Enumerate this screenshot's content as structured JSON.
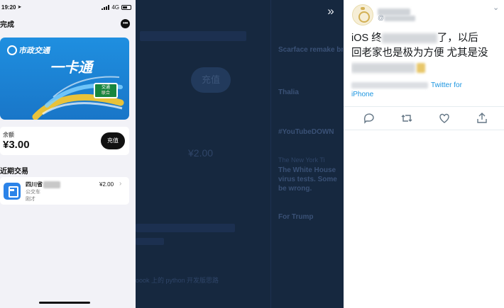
{
  "phone": {
    "status": {
      "time": "19:20",
      "network": "4G"
    },
    "nav": {
      "done_label": "完成",
      "more_glyph": "•••"
    },
    "card": {
      "logo_text": "市政交通",
      "big_text": "一卡通",
      "badge_top": "交通",
      "badge_bottom": "联合"
    },
    "balance": {
      "label": "余额",
      "value": "¥3.00",
      "recharge_label": "充值"
    },
    "recent": {
      "title": "近期交易",
      "transactions": [
        {
          "name": "四川省",
          "type": "公交车",
          "time": "刚才",
          "amount": "¥2.00"
        }
      ]
    }
  },
  "background": {
    "lines": [
      {
        "text": "充值"
      },
      {
        "text": "¥2.00"
      },
      {
        "text": "Scarface remake bri"
      },
      {
        "text": "Thalia"
      },
      {
        "text": "#YouTubeDOWN"
      },
      {
        "text": "The New York Ti"
      },
      {
        "text": "The White House"
      },
      {
        "text": "virus tests. Some"
      },
      {
        "text": "be wrong."
      },
      {
        "text": "For Trump"
      },
      {
        "text": "oook 上的 python 开发版思路"
      }
    ],
    "expand_glyph": "»"
  },
  "tweet": {
    "handle_prefix": "@",
    "text_line1_a": "iOS 终",
    "text_line1_b": "了，以后",
    "text_line2": "回老家也是极为方便  尤其是没",
    "meta_via": "Twitter for",
    "meta_device": "iPhone",
    "actions": [
      {
        "icon": "reply-icon"
      },
      {
        "icon": "retweet-icon"
      },
      {
        "icon": "like-icon"
      },
      {
        "icon": "share-icon"
      }
    ],
    "colors": {
      "link": "#1b95e0",
      "text": "#14171a",
      "muted": "#8a97a5"
    }
  }
}
